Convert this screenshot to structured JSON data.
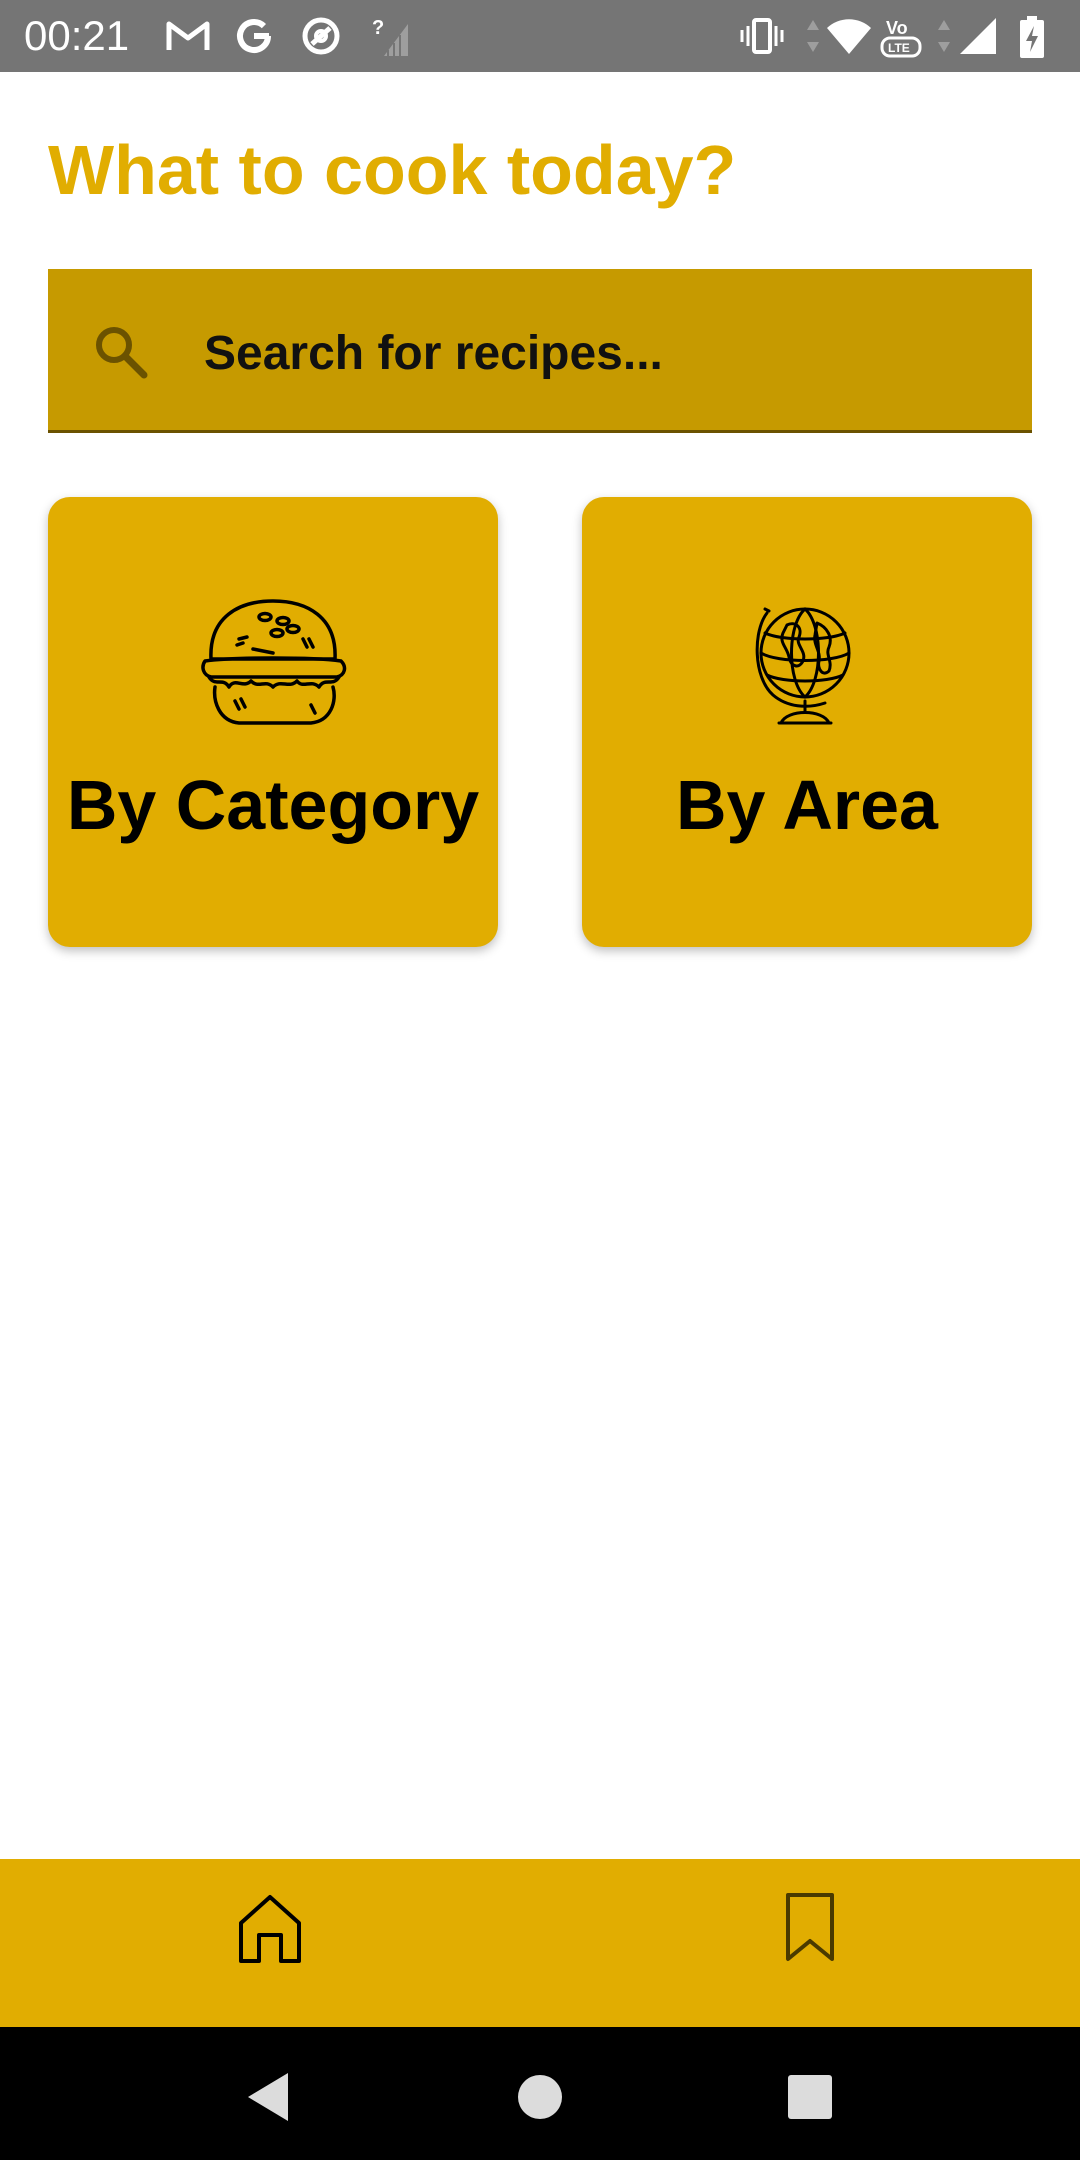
{
  "status_bar": {
    "time": "00:21",
    "left_icons": [
      "gmail-icon",
      "google-icon",
      "vpn-icon",
      "no-signal-icon"
    ],
    "right_icons": [
      "vibrate-icon",
      "wifi-icon",
      "volte-icon",
      "signal-icon",
      "battery-charging-icon"
    ],
    "volte_label": "VoLTE"
  },
  "header": {
    "title": "What to cook today?"
  },
  "search": {
    "placeholder": "Search for recipes...",
    "value": ""
  },
  "cards": [
    {
      "label": "By Category",
      "icon": "burger-icon"
    },
    {
      "label": "By Area",
      "icon": "globe-icon"
    }
  ],
  "bottom_nav": {
    "items": [
      {
        "icon": "home-icon",
        "active": true
      },
      {
        "icon": "bookmark-icon",
        "active": false
      }
    ]
  },
  "system_nav": {
    "buttons": [
      "back-icon",
      "home-circle-icon",
      "recents-icon"
    ]
  },
  "colors": {
    "accent": "#E1AD01",
    "search_bg": "#C69A00",
    "status_bar": "#757575",
    "system_nav": "#000000"
  }
}
